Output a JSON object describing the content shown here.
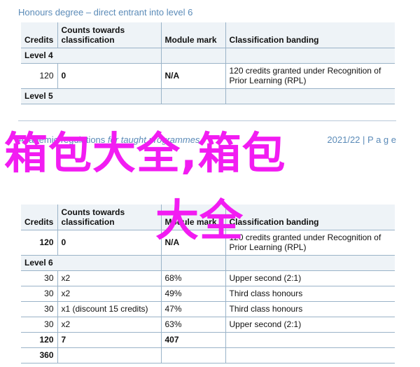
{
  "section_heading": "Honours degree – direct entrant into level 6",
  "columns": {
    "credits": "Credits",
    "counts": "Counts towards classification",
    "mark": "Module mark",
    "banding": "Classification banding"
  },
  "table1": {
    "level4_label": "Level 4",
    "row1": {
      "credits": "120",
      "counts": "0",
      "mark": "N/A",
      "banding": "120 credits granted under Recognition of Prior Learning (RPL)"
    },
    "level5_label": "Level 5"
  },
  "footer": {
    "title_start": "Academic regulations",
    "title_italic": "for taught programmes",
    "year": "2021/22",
    "page": "| P a g e"
  },
  "table2": {
    "row1": {
      "credits": "120",
      "counts": "0",
      "mark": "N/A",
      "banding": "120 credits granted under Recognition of Prior Learning (RPL)"
    },
    "level6_label": "Level 6",
    "rows": [
      {
        "credits": "30",
        "counts": "x2",
        "mark": "68%",
        "banding": "Upper second (2:1)"
      },
      {
        "credits": "30",
        "counts": "x2",
        "mark": "49%",
        "banding": "Third class honours"
      },
      {
        "credits": "30",
        "counts": "x1 (discount 15 credits)",
        "mark": "47%",
        "banding": "Third class honours"
      },
      {
        "credits": "30",
        "counts": "x2",
        "mark": "63%",
        "banding": "Upper second (2:1)"
      }
    ],
    "total_row": {
      "credits": "120",
      "counts": "7",
      "mark": "407",
      "banding": ""
    },
    "grand_total": {
      "credits": "360"
    }
  },
  "watermark": {
    "line1": "箱包大全,箱包",
    "line2": "大全",
    "color": "#f21cf2"
  }
}
